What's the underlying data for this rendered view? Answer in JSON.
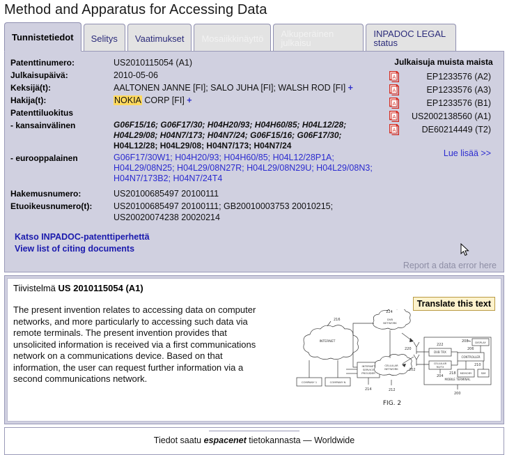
{
  "page_title": "Method and Apparatus for Accessing Data",
  "tabs": [
    {
      "label": "Tunnistetiedot",
      "state": "active"
    },
    {
      "label": "Selitys",
      "state": "enabled"
    },
    {
      "label": "Vaatimukset",
      "state": "enabled"
    },
    {
      "label": "Mosaiikkinäyttö",
      "state": "disabled"
    },
    {
      "label": "Alkuperäinen julkaisu",
      "state": "disabled"
    },
    {
      "label": "INPADOC LEGAL status",
      "state": "enabled"
    }
  ],
  "bibliography": {
    "patent_number_label": "Patenttinumero:",
    "patent_number_value": "US2010115054 (A1)",
    "publication_date_label": "Julkaisupäivä:",
    "publication_date_value": "2010-05-06",
    "inventors_label": "Keksijä(t):",
    "inventors_value": "AALTONEN JANNE [FI]; SALO JUHA [FI]; WALSH ROD [FI]",
    "inventors_plus": "+",
    "applicants_label": "Hakija(t):",
    "applicant_highlight": "NOKIA",
    "applicant_rest": "CORP [FI]",
    "applicants_plus": "+",
    "classification_label": "Patenttiluokitus",
    "ipc_label": "- kansainvälinen",
    "ipc_line1": "G06F15/16; G06F17/30; H04H20/93; H04H60/85; H04L12/28;",
    "ipc_line2": "H04L29/08; H04N7/173; H04N7/24; G06F15/16; G06F17/30;",
    "ipc_line3": "H04L12/28; H04L29/08; H04N7/173; H04N7/24",
    "ecla_label": "- eurooppalainen",
    "ecla_line1": "G06F17/30W1; H04H20/93; H04H60/85; H04L12/28P1A;",
    "ecla_line2": "H04L29/08N25; H04L29/08N27R; H04L29/08N29U; H04L29/08N3;",
    "ecla_line3": "H04N7/173B2; H04N7/24T4",
    "application_number_label": "Hakemusnumero:",
    "application_number_value": "US20100685497 20100111",
    "priority_label": "Etuoikeusnumero(t):",
    "priority_line1": "US20100685497 20100111; GB20010003753 20010215;",
    "priority_line2": "US20020074238 20020214"
  },
  "other_publications": {
    "title": "Julkaisuja muista maista",
    "items": [
      {
        "icon": "pdf-icon",
        "number": "EP1233576",
        "kind": "(A2)"
      },
      {
        "icon": "pdf-icon",
        "number": "EP1233576",
        "kind": "(A3)"
      },
      {
        "icon": "pdf-icon",
        "number": "EP1233576",
        "kind": "(B1)"
      },
      {
        "icon": "pdf-icon",
        "number": "US2002138560",
        "kind": "(A1)"
      },
      {
        "icon": "pdf-icon",
        "number": "DE60214449",
        "kind": "(T2)"
      }
    ],
    "read_more": "Lue lisää >>"
  },
  "panel_links": {
    "inpadoc_family": "Katso INPADOC-patenttiperhettä",
    "citing_documents": "View list of citing documents",
    "report_error": "Report a data error here"
  },
  "abstract": {
    "head_prefix": "Tiivistelmä",
    "head_number": "US 2010115054",
    "head_kind": "(A1)",
    "translate_button": "Translate this text",
    "text": "The present invention relates to accessing data on computer networks, and more particularly to accessing such data via remote terminals. The present invention provides that unsolicited information is received via a first communications network on a communications device. Based on that information, the user can request further information via a second communications network."
  },
  "figure": {
    "caption": "FIG. 2",
    "nodes": {
      "internet": "INTERNET",
      "internet_ref": "216",
      "company1": "COMPANY 1",
      "companyN": "COMPANY N",
      "isp": "INTERNET SERVICE PROVIDER",
      "isp_ref": "214",
      "dvb_network": "DVB NETWORK",
      "dvb_ref": "224",
      "cellular_network": "CELLULAR NETWORK",
      "cellular_ref": "212",
      "ant_dvb_ref": "220",
      "ant_cell_ref": "202",
      "dvb_trx": "DVB TRX",
      "dvb_trx_ref": "222",
      "cellular_rxtx": "CELLULAR RX/TX",
      "cellular_rxtx_ref": "204",
      "controller": "CONTROLLER",
      "controller_ref": "206",
      "display": "DISPLAY",
      "display_ref": "208",
      "memory": "MEMORY",
      "memory_ref": "218",
      "sim": "SIM",
      "sim_ref": "210",
      "mobile_terminal": "MOBILE TERMINAL",
      "mobile_terminal_ref": "200"
    }
  },
  "footer": {
    "prefix": "Tiedot saatu",
    "emphasis": "espacenet",
    "suffix": "tietokannasta — Worldwide"
  },
  "colors": {
    "panel_bg": "#d0d0e0",
    "tab_inactive": "#e3e3e3",
    "link_blue": "#1a1aad",
    "ecla_blue": "#2b2bcf",
    "highlight_yellow": "#ffd95e",
    "translate_bg": "#fdf2cd",
    "pdf_red": "#d42b20",
    "muted_gray": "#8e8ea5"
  }
}
